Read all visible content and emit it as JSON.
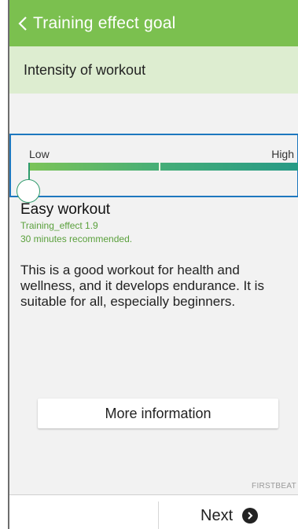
{
  "header": {
    "title": "Training effect goal",
    "back_icon": "chevron-left-icon"
  },
  "subheader": {
    "label": "Intensity of workout"
  },
  "slider": {
    "low_label": "Low",
    "high_label": "High",
    "level": 0.0
  },
  "workout": {
    "title": "Easy workout",
    "effect": "Training_effect 1.9",
    "recommendation": "30 minutes recommended.",
    "description": "This is a good workout for health and wellness, and it develops endurance. It is suitable for all, especially beginners."
  },
  "more_button": {
    "label": "More information"
  },
  "footer": {
    "brand": "FIRSTBEAT",
    "next_label": "Next",
    "next_icon": "chevron-right-circle-icon"
  },
  "colors": {
    "appbar": "#7bc04f",
    "subheader": "#ddedd0",
    "accent_text": "#5aa03c",
    "selection_border": "#1e78bf"
  }
}
